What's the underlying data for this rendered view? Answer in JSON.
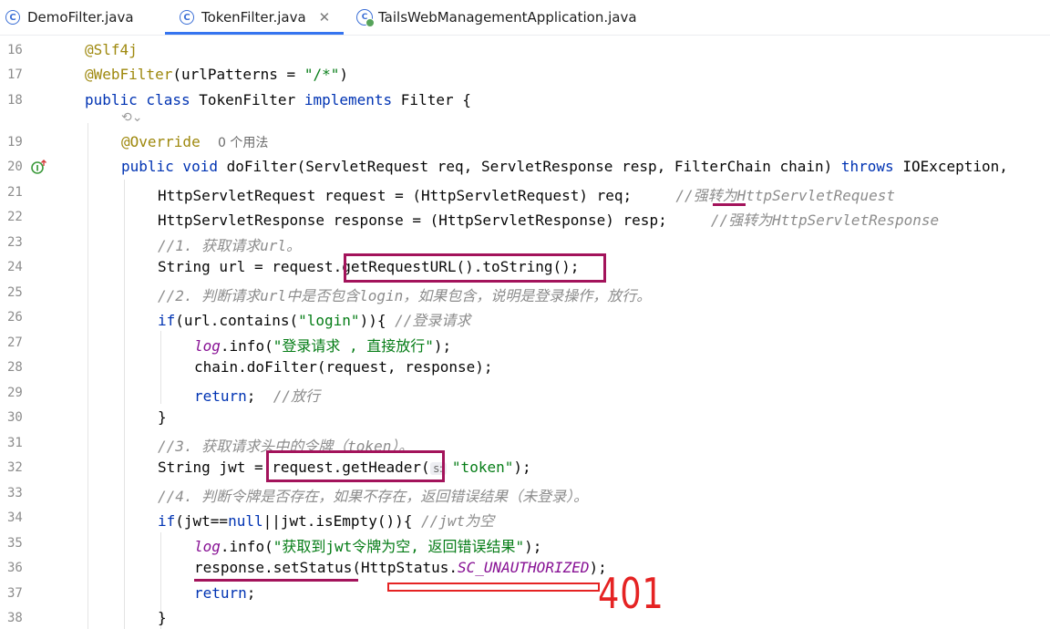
{
  "tabs": [
    {
      "label": "DemoFilter.java",
      "icon": "class-icon"
    },
    {
      "label": "TokenFilter.java",
      "icon": "class-icon",
      "active": true
    },
    {
      "label": "TailsWebManagementApplication.java",
      "icon": "spring-boot-class-icon"
    }
  ],
  "line_numbers": [
    "16",
    "17",
    "18",
    "19",
    "20",
    "21",
    "22",
    "23",
    "24",
    "25",
    "26",
    "27",
    "28",
    "29",
    "30",
    "31",
    "32",
    "33",
    "34",
    "35",
    "36",
    "37",
    "38"
  ],
  "code": {
    "l16": "@Slf4j",
    "l17_a": "@WebFilter",
    "l17_b": "(urlPatterns = ",
    "l17_c": "\"/*\"",
    "l17_d": ")",
    "l18_a": "public class ",
    "l18_b": "TokenFilter ",
    "l18_c": "implements ",
    "l18_d": "Filter {",
    "l19_a": "@Override",
    "l19_usages": "0 个用法",
    "l20_a": "public void ",
    "l20_b": "doFilter(ServletRequest req, ServletResponse resp, FilterChain chain) ",
    "l20_c": "throws ",
    "l20_d": "IOException,",
    "l21_a": "HttpServletRequest request = (HttpServletRequest) req;",
    "l21_b": "//强转为HttpServletRequest",
    "l22_a": "HttpServletResponse response = (HttpServletResponse) resp;",
    "l22_b": "//强转为HttpServletResponse",
    "l23": "//1. 获取请求url。",
    "l24_a": "String url = request.",
    "l24_b": "getRequestURL().toString();",
    "l25": "//2. 判断请求url中是否包含login，如果包含，说明是登录操作，放行。",
    "l26_a": "if",
    "l26_b": "(url.contains(",
    "l26_c": "\"login\"",
    "l26_d": ")){ ",
    "l26_e": "//登录请求",
    "l27_a": "log",
    "l27_b": ".info(",
    "l27_c": "\"登录请求 , 直接放行\"",
    "l27_d": ");",
    "l28": "chain.doFilter(request, response);",
    "l29_a": "return",
    "l29_b": ";  ",
    "l29_c": "//放行",
    "l30": "}",
    "l31": "//3. 获取请求头中的令牌（token）。",
    "l32_a": "String jwt = ",
    "l32_b": "request.getHeader(",
    "l32_hint": "s:",
    "l32_c": "\"token\"",
    "l32_d": ");",
    "l33": "//4. 判断令牌是否存在，如果不存在，返回错误结果（未登录）。",
    "l34_a": "if",
    "l34_b": "(jwt==",
    "l34_c": "null",
    "l34_d": "||jwt.isEmpty()){ ",
    "l34_e": "//jwt为空",
    "l35_a": "log",
    "l35_b": ".info(",
    "l35_c": "\"获取到jwt令牌为空, 返回错误结果\"",
    "l35_d": ");",
    "l36_a": "response.setStatus",
    "l36_b": "(HttpStatus.",
    "l36_c": "SC_UNAUTHORIZED",
    "l36_d": ");",
    "l37_a": "return",
    "l37_b": ";",
    "l38": "}"
  },
  "annotation_401": "401",
  "colors": {
    "keyword": "#0033b3",
    "annotation": "#9e880d",
    "string": "#067d17",
    "comment": "#8c8c8c",
    "field": "#871094",
    "highlight_box": "#a3135b",
    "red_annotation": "#e52323",
    "tab_underline": "#3574f0"
  }
}
